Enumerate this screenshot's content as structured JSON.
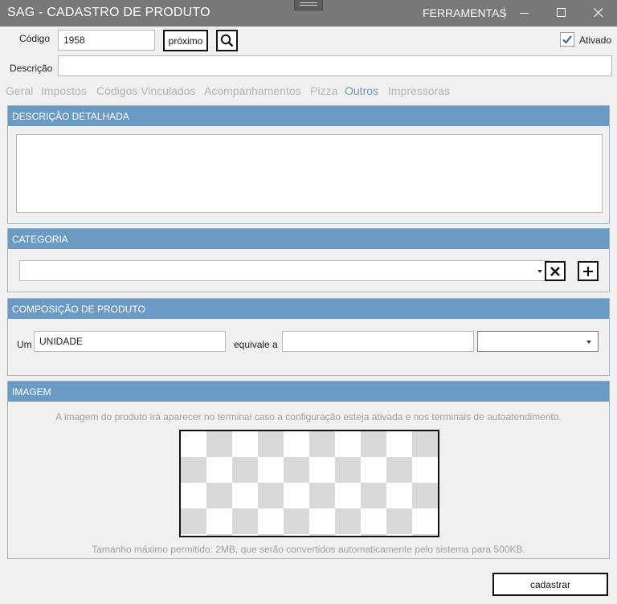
{
  "window": {
    "title": "SAG - CADASTRO DE PRODUTO",
    "tools_menu": "FERRAMENTAS",
    "minimize_icon": "minimize-icon",
    "maximize_icon": "maximize-icon",
    "close_icon": "close-icon"
  },
  "form": {
    "codigo_label": "Código",
    "codigo_value": "1958",
    "proximo_label": "próximo",
    "search_icon": "search-icon",
    "ativado_label": "Ativado",
    "ativado_checked": true,
    "descricao_label": "Descrição",
    "descricao_value": ""
  },
  "tabs": [
    {
      "label": "Geral",
      "active": false
    },
    {
      "label": "Impostos",
      "active": false
    },
    {
      "label": "Códigos Vinculados",
      "active": false
    },
    {
      "label": "Acompanhamentos",
      "active": false
    },
    {
      "label": "Pizza",
      "active": false
    },
    {
      "label": "Outros",
      "active": true
    },
    {
      "label": "Impressoras",
      "active": false
    }
  ],
  "descricao_detalhada": {
    "header": "DESCRIÇÃO DETALHADA",
    "value": ""
  },
  "categoria": {
    "header": "CATEGORIA",
    "selected": "",
    "clear_icon": "close-icon",
    "add_icon": "plus-icon"
  },
  "composicao": {
    "header": "COMPOSIÇÃO DE PRODUTO",
    "um_label": "Um",
    "unidade_value": "UNIDADE",
    "equivale_label": "equivale a",
    "quantidade_value": "",
    "unit_selected": ""
  },
  "imagem": {
    "header": "IMAGEM",
    "note_top": "A imagem do produto irá aparecer no terminal caso a configuração esteja ativada e nos terminais de autoatendimento.",
    "note_bottom": "Tamanho máximo permitido: 2MB, que serão convertidos automaticamente pelo sistema para 500KB."
  },
  "actions": {
    "cadastrar_label": "cadastrar"
  },
  "colors": {
    "titlebar": "#76787a",
    "panel_header": "#6b9ac4",
    "active_tab": "#7094bf",
    "inactive_tab": "#b4b4b4"
  }
}
